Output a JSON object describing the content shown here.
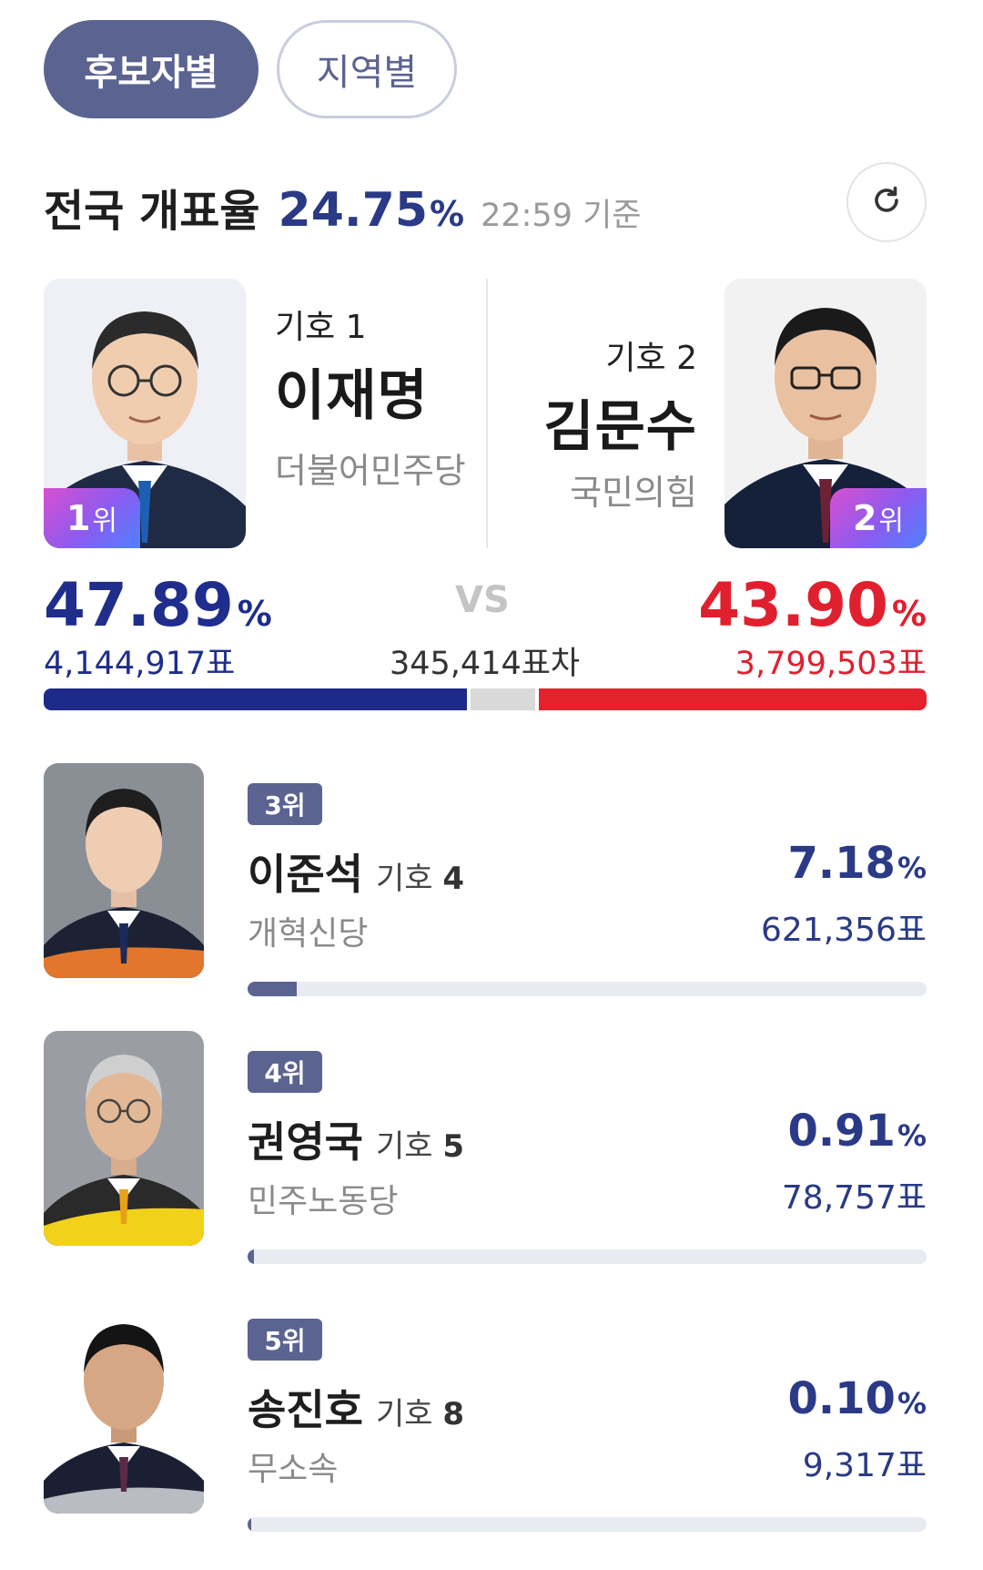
{
  "tabs": [
    {
      "label": "후보자별",
      "active": true
    },
    {
      "label": "지역별",
      "active": false
    }
  ],
  "status": {
    "label": "전국 개표율",
    "rate": "24.75",
    "pct_sign": "%",
    "time": "22:59 기준"
  },
  "top": {
    "left": {
      "symbol": "기호 1",
      "name": "이재명",
      "party": "더불어민주당",
      "rank_num": "1",
      "rank_unit": "위",
      "pct": "47.89",
      "pct_sign": "%",
      "votes": "4,144,917표",
      "share": 47.89,
      "color": "#1e2a8a"
    },
    "right": {
      "symbol": "기호 2",
      "name": "김문수",
      "party": "국민의힘",
      "rank_num": "2",
      "rank_unit": "위",
      "pct": "43.90",
      "pct_sign": "%",
      "votes": "3,799,503표",
      "share": 43.9,
      "color": "#e4222e"
    },
    "vs": "VS",
    "difference": "345,414표차"
  },
  "others": [
    {
      "rank": "3위",
      "name": "이준석",
      "symbol_prefix": "기호",
      "symbol_num": "4",
      "party": "개혁신당",
      "pct": "7.18",
      "pct_sign": "%",
      "votes": "621,356표",
      "share": 7.18
    },
    {
      "rank": "4위",
      "name": "권영국",
      "symbol_prefix": "기호",
      "symbol_num": "5",
      "party": "민주노동당",
      "pct": "0.91",
      "pct_sign": "%",
      "votes": "78,757표",
      "share": 0.91
    },
    {
      "rank": "5위",
      "name": "송진호",
      "symbol_prefix": "기호",
      "symbol_num": "8",
      "party": "무소속",
      "pct": "0.10",
      "pct_sign": "%",
      "votes": "9,317표",
      "share": 0.1
    }
  ],
  "colors": {
    "accent": "#5b6391",
    "blue": "#1e2a8a",
    "red": "#e4222e"
  },
  "icons": {
    "refresh": "refresh-icon"
  }
}
